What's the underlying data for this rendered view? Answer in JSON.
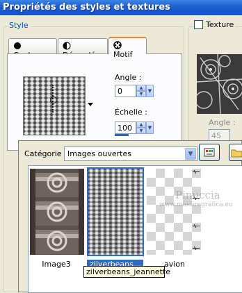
{
  "window": {
    "title": "Propriétés des styles et textures"
  },
  "style_group": {
    "label": "Style"
  },
  "texture_group": {
    "label": "Texture",
    "checked": false,
    "angle_label": "Angle :",
    "angle_value": "45"
  },
  "tabs": [
    {
      "label": "Couleur",
      "icon": "color-dot-icon",
      "active": false
    },
    {
      "label": "Dégradé",
      "icon": "gradient-icon",
      "active": false
    },
    {
      "label": "Motif",
      "icon": "pattern-icon",
      "active": true
    }
  ],
  "pattern": {
    "angle_label": "Angle :",
    "angle_value": "0",
    "scale_label": "Échelle :",
    "scale_value": "100"
  },
  "popup": {
    "category_label": "Catégorie :",
    "category_value": "Images ouvertes",
    "thumbnails": [
      {
        "caption": "Image3",
        "selected": false
      },
      {
        "caption": "zilverbeans...",
        "selected": true
      },
      {
        "caption": "avion",
        "selected": false
      }
    ],
    "tooltip": "zilverbeans_jeannette"
  },
  "watermark": {
    "line1": "Pinuccia",
    "line2": "www.maidiregrafica.eu"
  }
}
